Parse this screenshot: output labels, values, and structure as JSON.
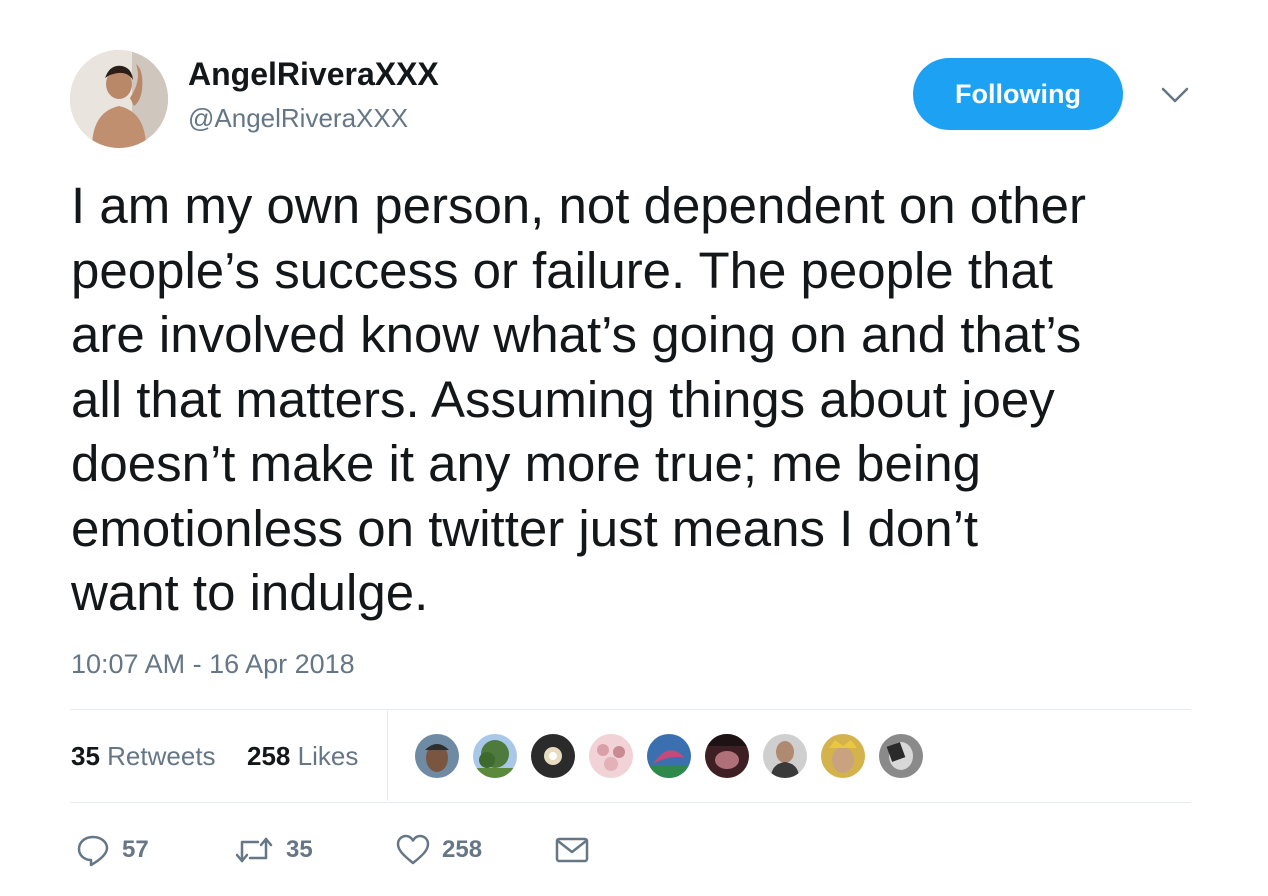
{
  "user": {
    "display_name": "AngelRiveraXXX",
    "screen_name": "@AngelRiveraXXX",
    "avatar_icon": "user-avatar"
  },
  "follow_button": {
    "label": "Following",
    "color": "#1da1f2"
  },
  "more_menu_icon": "chevron-down-icon",
  "tweet": {
    "text": "I am my own person, not dependent on other\npeople’s success or failure. The people that\nare involved know what’s going on and that’s\nall that matters. Assuming things about joey\ndoesn’t make it any more true; me being\nemotionless on twitter just means I don’t\nwant to indulge.",
    "timestamp": "10:07 AM - 16 Apr 2018"
  },
  "stats": {
    "retweets_count": "35",
    "retweets_label": "Retweets",
    "likes_count": "258",
    "likes_label": "Likes"
  },
  "likers": [
    {
      "name": "liker-avatar-1",
      "color": "#6f8aa3"
    },
    {
      "name": "liker-avatar-2",
      "color": "#4f7a3e"
    },
    {
      "name": "liker-avatar-3",
      "color": "#2b2b2b"
    },
    {
      "name": "liker-avatar-4",
      "color": "#d9a0a8"
    },
    {
      "name": "liker-avatar-5",
      "color": "#3a6fb0"
    },
    {
      "name": "liker-avatar-6",
      "color": "#3d1f24"
    },
    {
      "name": "liker-avatar-7",
      "color": "#4a4a4a"
    },
    {
      "name": "liker-avatar-8",
      "color": "#d4b24c"
    },
    {
      "name": "liker-avatar-9",
      "color": "#8a8a8a"
    }
  ],
  "actions": {
    "reply_count": "57",
    "retweet_count": "35",
    "like_count": "258"
  },
  "colors": {
    "text_primary": "#14171a",
    "text_secondary": "#657786",
    "divider": "#e6ecf0",
    "accent": "#1da1f2"
  }
}
